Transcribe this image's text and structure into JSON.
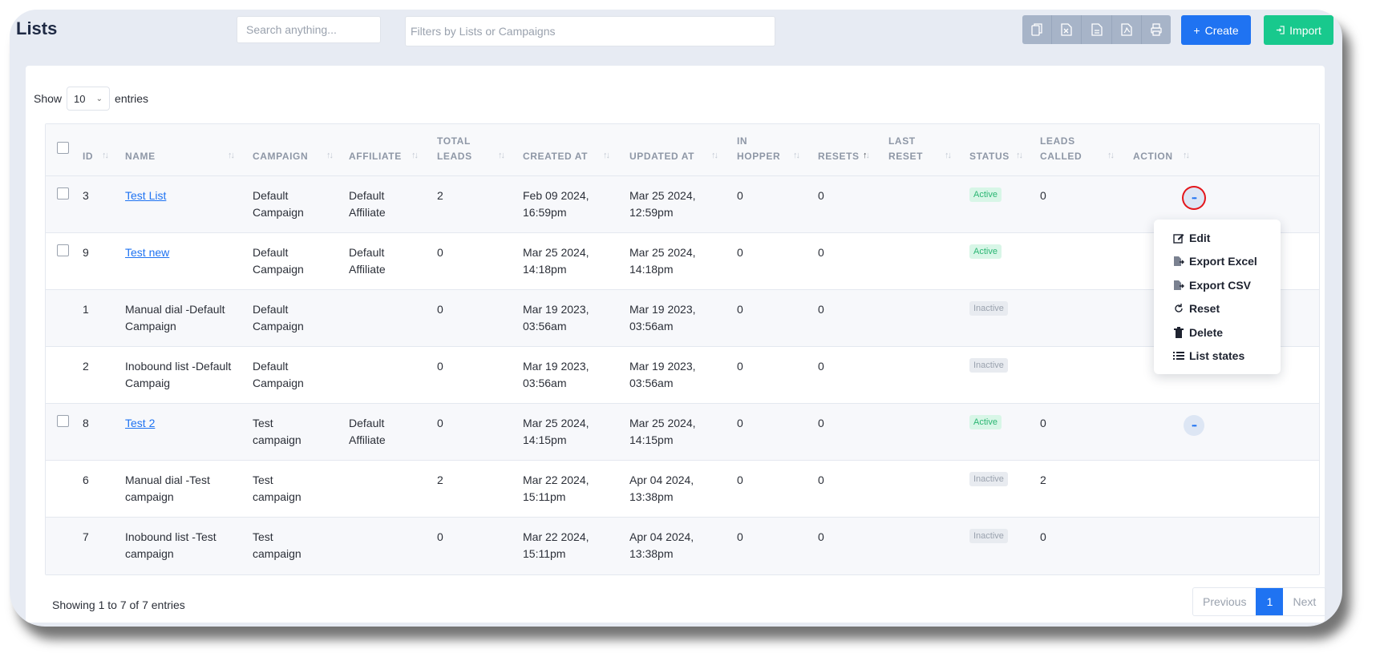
{
  "header": {
    "title": "Lists",
    "search_placeholder": "Search anything...",
    "filter_placeholder": "Filters by Lists or Campaigns",
    "export_icons": [
      "copy-icon",
      "excel-icon",
      "csv-icon",
      "pdf-icon",
      "print-icon"
    ],
    "create_label": "Create",
    "import_label": "Import"
  },
  "table_controls": {
    "show_label": "Show",
    "entries_value": "10",
    "entries_label": "entries"
  },
  "columns": [
    {
      "key": "id",
      "label": "ID"
    },
    {
      "key": "name",
      "label": "NAME"
    },
    {
      "key": "campaign",
      "label": "CAMPAIGN"
    },
    {
      "key": "affiliate",
      "label": "AFFILIATE"
    },
    {
      "key": "total_leads",
      "label": "TOTAL LEADS"
    },
    {
      "key": "created_at",
      "label": "CREATED AT"
    },
    {
      "key": "updated_at",
      "label": "UPDATED AT"
    },
    {
      "key": "in_hopper",
      "label": "IN HOPPER"
    },
    {
      "key": "resets",
      "label": "RESETS"
    },
    {
      "key": "last_reset",
      "label": "LAST RESET"
    },
    {
      "key": "status",
      "label": "STATUS"
    },
    {
      "key": "leads_called",
      "label": "LEADS CALLED"
    },
    {
      "key": "action",
      "label": "ACTION"
    }
  ],
  "rows": [
    {
      "checkbox": true,
      "id": "3",
      "name": "Test List",
      "link": true,
      "campaign": "Default Campaign",
      "affiliate": "Default Affiliate",
      "total_leads": "2",
      "created_at": "Feb 09 2024, 16:59pm",
      "updated_at": "Mar 25 2024, 12:59pm",
      "in_hopper": "0",
      "resets": "0",
      "last_reset": "",
      "status": "Active",
      "leads_called": "0",
      "action": true
    },
    {
      "checkbox": true,
      "id": "9",
      "name": "Test new",
      "link": true,
      "campaign": "Default Campaign",
      "affiliate": "Default Affiliate",
      "total_leads": "0",
      "created_at": "Mar 25 2024, 14:18pm",
      "updated_at": "Mar 25 2024, 14:18pm",
      "in_hopper": "0",
      "resets": "0",
      "last_reset": "",
      "status": "Active",
      "leads_called": "",
      "action": false
    },
    {
      "checkbox": false,
      "id": "1",
      "name": "Manual dial -Default Campaign",
      "link": false,
      "campaign": "Default Campaign",
      "affiliate": "",
      "total_leads": "0",
      "created_at": "Mar 19 2023, 03:56am",
      "updated_at": "Mar 19 2023, 03:56am",
      "in_hopper": "0",
      "resets": "0",
      "last_reset": "",
      "status": "Inactive",
      "leads_called": "",
      "action": false
    },
    {
      "checkbox": false,
      "id": "2",
      "name": "Inobound list -Default Campaig",
      "link": false,
      "campaign": "Default Campaign",
      "affiliate": "",
      "total_leads": "0",
      "created_at": "Mar 19 2023, 03:56am",
      "updated_at": "Mar 19 2023, 03:56am",
      "in_hopper": "0",
      "resets": "0",
      "last_reset": "",
      "status": "Inactive",
      "leads_called": "",
      "action": false
    },
    {
      "checkbox": true,
      "id": "8",
      "name": "Test 2",
      "link": true,
      "campaign": "Test campaign",
      "affiliate": "Default Affiliate",
      "total_leads": "0",
      "created_at": "Mar 25 2024, 14:15pm",
      "updated_at": "Mar 25 2024, 14:15pm",
      "in_hopper": "0",
      "resets": "0",
      "last_reset": "",
      "status": "Active",
      "leads_called": "0",
      "action": true
    },
    {
      "checkbox": false,
      "id": "6",
      "name": "Manual dial -Test campaign",
      "link": false,
      "campaign": "Test campaign",
      "affiliate": "",
      "total_leads": "2",
      "created_at": "Mar 22 2024, 15:11pm",
      "updated_at": "Apr 04 2024, 13:38pm",
      "in_hopper": "0",
      "resets": "0",
      "last_reset": "",
      "status": "Inactive",
      "leads_called": "2",
      "action": false
    },
    {
      "checkbox": false,
      "id": "7",
      "name": "Inobound list -Test campaign",
      "link": false,
      "campaign": "Test campaign",
      "affiliate": "",
      "total_leads": "0",
      "created_at": "Mar 22 2024, 15:11pm",
      "updated_at": "Apr 04 2024, 13:38pm",
      "in_hopper": "0",
      "resets": "0",
      "last_reset": "",
      "status": "Inactive",
      "leads_called": "0",
      "action": false
    }
  ],
  "action_menu": {
    "items": [
      {
        "label": "Edit",
        "icon": "edit-icon"
      },
      {
        "label": "Export Excel",
        "icon": "export-excel-icon"
      },
      {
        "label": "Export CSV",
        "icon": "export-csv-icon"
      },
      {
        "label": "Reset",
        "icon": "reset-icon"
      },
      {
        "label": "Delete",
        "icon": "trash-icon"
      },
      {
        "label": "List states",
        "icon": "list-icon"
      }
    ]
  },
  "footer": {
    "info": "Showing 1 to 7 of 7 entries",
    "previous_label": "Previous",
    "current_page": "1",
    "next_label": "Next"
  },
  "colors": {
    "primary": "#1f73f2",
    "success": "#18c98d",
    "highlight_ring": "#e4161b"
  }
}
